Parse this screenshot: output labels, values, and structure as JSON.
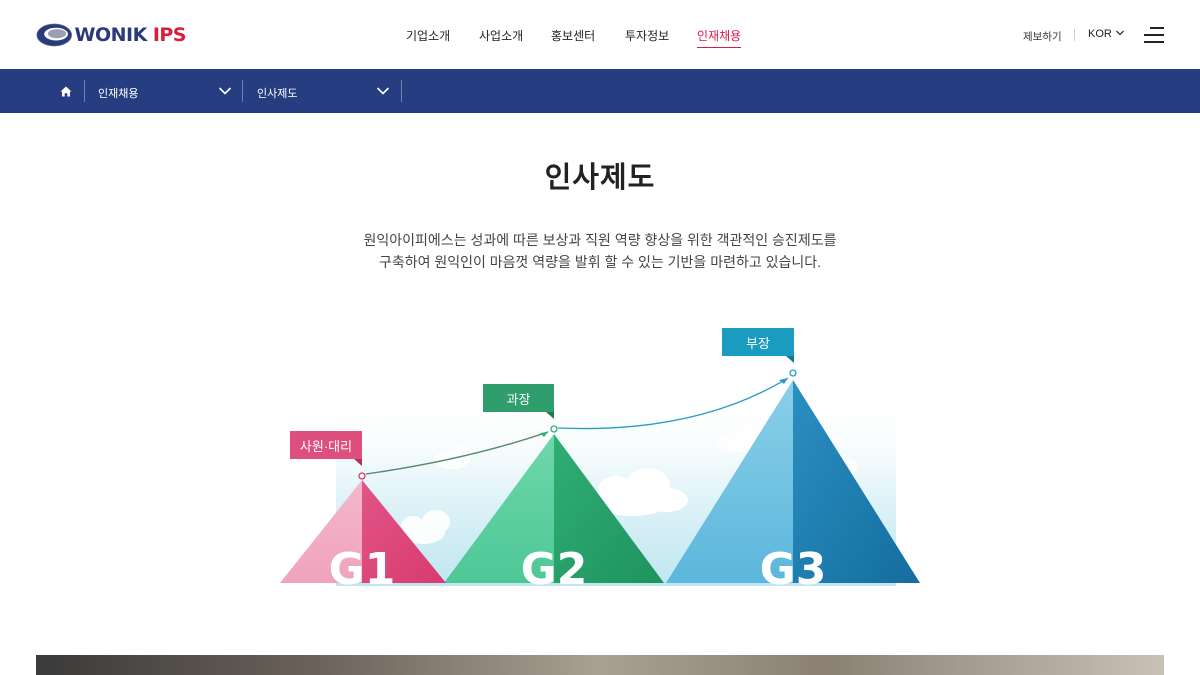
{
  "header": {
    "logo": {
      "wonik": "WONIK",
      "ips": "IPS"
    },
    "gnb": [
      {
        "label": "기업소개",
        "active": false
      },
      {
        "label": "사업소개",
        "active": false
      },
      {
        "label": "홍보센터",
        "active": false
      },
      {
        "label": "투자정보",
        "active": false
      },
      {
        "label": "인재채용",
        "active": true
      }
    ],
    "report_label": "제보하기",
    "language": "KOR",
    "accent": "#d81c4a"
  },
  "subnav": {
    "background": "#263d82",
    "dropdown1": "인재채용",
    "dropdown2": "인사제도"
  },
  "main": {
    "title": "인사제도",
    "desc_line1": "원익아이피에스는 성과에 따른 보상과 직원 역량 향상을 위한 객관적인 승진제도를",
    "desc_line2": "구축하여 원익인이 마음껏 역량을 발휘 할 수 있는 기반을 마련하고 있습니다."
  },
  "diagram": {
    "levels": [
      {
        "grade": "G1",
        "title": "사원·대리",
        "color": "#e0507e"
      },
      {
        "grade": "G2",
        "title": "과장",
        "color": "#2f9e6c"
      },
      {
        "grade": "G3",
        "title": "부장",
        "color": "#1a9cc0"
      }
    ]
  }
}
